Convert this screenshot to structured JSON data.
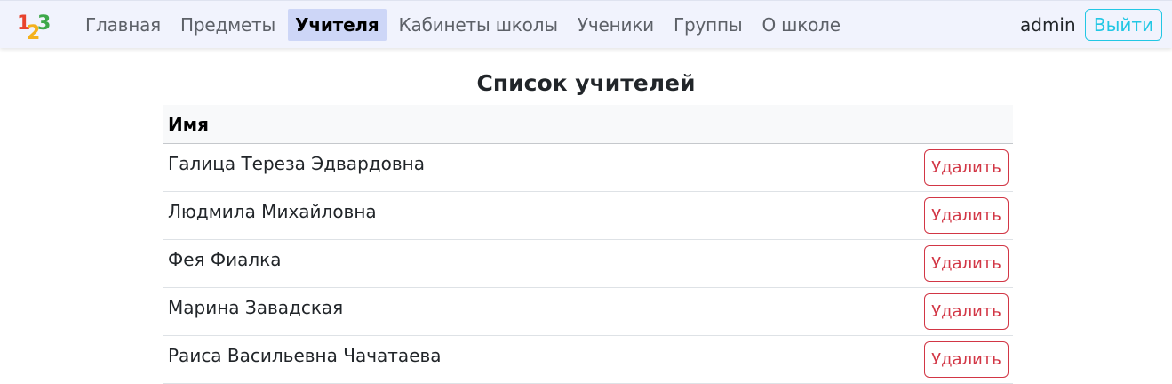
{
  "brand": {
    "logo_icon": "numbers-123-logo-icon",
    "logo_text": "123",
    "logo_colors": [
      "#e8432e",
      "#f4b11d",
      "#3ea84a"
    ]
  },
  "nav": {
    "items": [
      {
        "label": "Главная",
        "active": false
      },
      {
        "label": "Предметы",
        "active": false
      },
      {
        "label": "Учителя",
        "active": true
      },
      {
        "label": "Кабинеты школы",
        "active": false
      },
      {
        "label": "Ученики",
        "active": false
      },
      {
        "label": "Группы",
        "active": false
      },
      {
        "label": "О школе",
        "active": false
      }
    ]
  },
  "user": {
    "name": "admin",
    "logout_label": "Выйти"
  },
  "page": {
    "title": "Список учителей"
  },
  "table": {
    "header": "Имя",
    "delete_label": "Удалить",
    "rows": [
      {
        "name": "Галица Тереза Эдвардовна"
      },
      {
        "name": "Людмила Михайловна"
      },
      {
        "name": "Фея Фиалка"
      },
      {
        "name": "Марина Завадская"
      },
      {
        "name": "Раиса Васильевна Чачатаева"
      }
    ]
  },
  "colors": {
    "navbar_bg": "#f1f3fd",
    "active_bg": "#cdd6f7",
    "logout": "#22c7e4",
    "delete": "#d23645"
  }
}
